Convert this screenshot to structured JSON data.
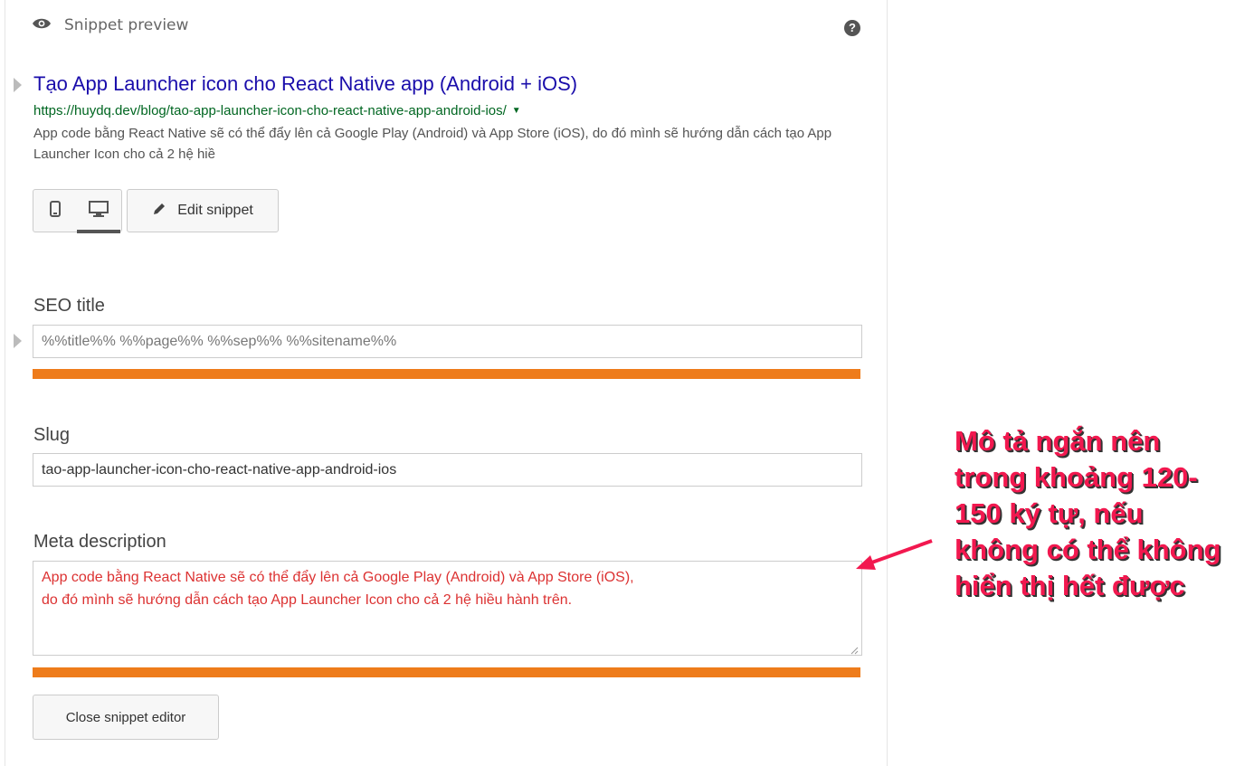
{
  "header": {
    "icon": "eye-icon",
    "label": "Snippet preview",
    "help_icon": "question-mark-icon",
    "help_glyph": "?"
  },
  "serp": {
    "title": "Tạo App Launcher icon cho React Native app (Android + iOS)",
    "url": "https://huydq.dev/blog/tao-app-launcher-icon-cho-react-native-app-android-ios/",
    "url_arrow": "▼",
    "description": "App code bằng React Native sẽ có thể đẩy lên cả Google Play (Android) và App Store (iOS), do đó mình sẽ hướng dẫn cách tạo App Launcher Icon cho cả 2 hệ hiề"
  },
  "toolbar": {
    "mobile_icon": "mobile-icon",
    "desktop_icon": "desktop-icon",
    "edit_icon": "pencil-icon",
    "edit_label": "Edit snippet"
  },
  "seo_title": {
    "label": "SEO title",
    "value": "%%title%% %%page%% %%sep%% %%sitename%%",
    "progress_color": "#ee7c1b"
  },
  "slug": {
    "label": "Slug",
    "value": "tao-app-launcher-icon-cho-react-native-app-android-ios"
  },
  "meta_description": {
    "label": "Meta description",
    "value": "App code bằng React Native sẽ có thể đẩy lên cả Google Play (Android) và App Store (iOS),\ndo đó mình sẽ hướng dẫn cách tạo App Launcher Icon cho cả 2 hệ hiều hành trên.",
    "text_color": "#dc3232",
    "progress_color": "#ee7c1b"
  },
  "close_label": "Close snippet editor",
  "annotation": {
    "text": "Mô tả ngắn nên trong khoảng 120-150 ký tự, nếu không có thể không hiển thị hết được",
    "color": "#f2184f"
  }
}
